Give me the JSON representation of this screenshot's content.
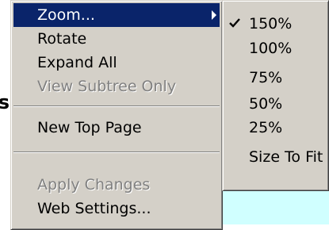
{
  "background": {
    "partial_text": "s",
    "panel_color": "#d0ffff"
  },
  "context_menu": {
    "items": [
      {
        "label": "Zoom...",
        "state": "highlighted",
        "submenu_icon": "chevron-right-icon"
      },
      {
        "label": "Rotate",
        "state": "enabled"
      },
      {
        "label": "Expand All",
        "state": "enabled"
      },
      {
        "label": "View Subtree Only",
        "state": "disabled"
      },
      {
        "label": "New Top Page",
        "state": "enabled"
      },
      {
        "label": "Apply Changes",
        "state": "disabled"
      },
      {
        "label": "Web Settings...",
        "state": "enabled"
      }
    ]
  },
  "zoom_submenu": {
    "checked_icon": "checkmark-icon",
    "selected": "150%",
    "items": [
      {
        "label": "150%",
        "checked": true
      },
      {
        "label": "100%",
        "checked": false
      },
      {
        "label": "75%",
        "checked": false
      },
      {
        "label": "50%",
        "checked": false
      },
      {
        "label": "25%",
        "checked": false
      },
      {
        "label": "Size To Fit",
        "checked": false
      }
    ]
  },
  "colors": {
    "menu_face": "#d4d0c8",
    "highlight": "#0a246a",
    "highlight_text": "#ffffff",
    "disabled_text": "#808080"
  }
}
